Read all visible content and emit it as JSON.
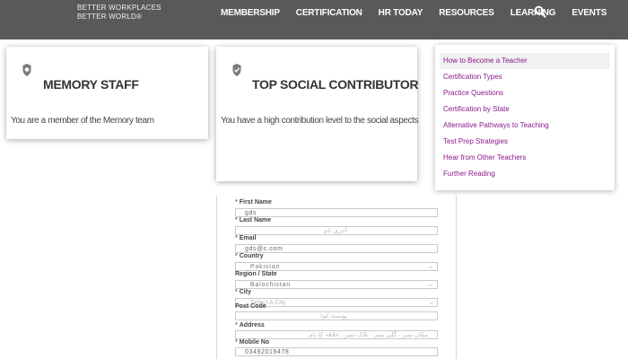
{
  "header": {
    "logo_line1": "BETTER WORKPLACES",
    "logo_line2": "BETTER WORLD®",
    "nav": [
      "MEMBERSHIP",
      "CERTIFICATION",
      "HR TODAY",
      "RESOURCES",
      "LEARNING",
      "EVENTS"
    ],
    "search_icon": "search-icon"
  },
  "cards": [
    {
      "icon": "badge-icon",
      "title": "MEMORY STAFF",
      "description": "You are a member of the Memory team"
    },
    {
      "icon": "check-badge-icon",
      "title": "TOP SOCIAL CONTRIBUTOR",
      "description": "You have a high contribution level to the social aspects"
    }
  ],
  "menu": {
    "items": [
      "How to Become a Teacher",
      "Certification Types",
      "Practice Questions",
      "Certification by State",
      "Alternative Pathways to Teaching",
      "Test Prep Strategies",
      "Hear from Other Teachers",
      "Further Reading"
    ],
    "active_index": 0,
    "link_color": "#8b1a8b"
  },
  "form": {
    "first_name": {
      "label": "First Name",
      "value": "gds"
    },
    "last_name": {
      "label": "Last Name",
      "placeholder": "آخری نام"
    },
    "email": {
      "label": "Email",
      "value": "gds@c.com"
    },
    "country": {
      "label": "Country",
      "value": "Pakistan"
    },
    "region": {
      "label": "Region / State",
      "value": "Balochistan"
    },
    "city": {
      "label": "City",
      "placeholder": "Select A City"
    },
    "post_code": {
      "label": "Post Code",
      "placeholder": "پوسٹ کوڈ"
    },
    "address": {
      "label": "Address",
      "placeholder": "مکان نمبر ، گلی نمبر ، بلاک نمبر ، علاقہ کا نام"
    },
    "mobile": {
      "label": "Mobile No",
      "value": "03492019478"
    }
  },
  "colors": {
    "topbar": "#57595b",
    "required_marker": "#3a9a3a"
  }
}
